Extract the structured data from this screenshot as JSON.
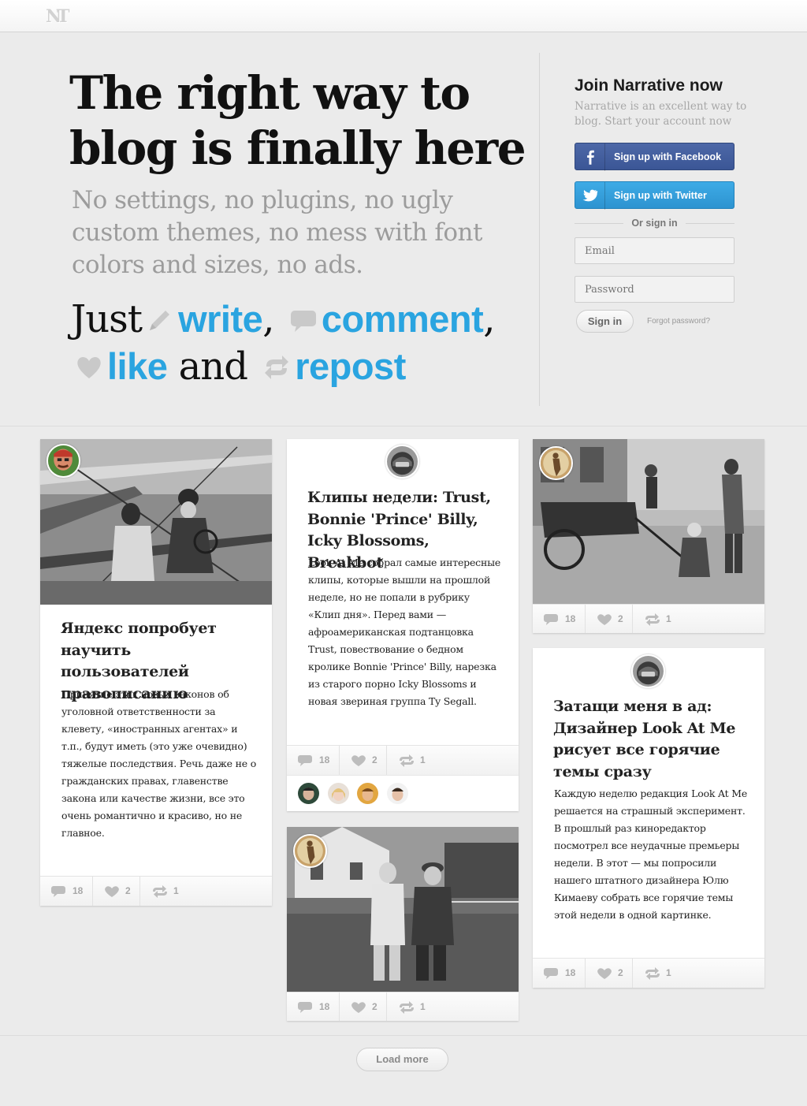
{
  "hero": {
    "headline": "The right way to blog is finally here",
    "subhead": "No settings, no plugins, no ugly custom themes, no mess with font colors and sizes, no ads.",
    "just": "Just",
    "write": "write",
    "comma1": ",",
    "comment": "comment",
    "comma2": ",",
    "like": "like",
    "and": "and",
    "repost": "repost",
    "accent_color": "#2aa4e0"
  },
  "signup": {
    "title": "Join Narrative now",
    "lead": "Narrative is an excellent way to blog. Start your account now",
    "facebook_label": "Sign up with Facebook",
    "twitter_label": "Sign up with Twitter",
    "or_sign_in": "Or sign in",
    "email_placeholder": "Email",
    "password_placeholder": "Password",
    "sign_in_label": "Sign in",
    "forgot_label": "Forgot password?",
    "facebook_color": "#3b5696",
    "twitter_color": "#2d93d0"
  },
  "posts": [
    {
      "title": "Яндекс попробует научить пользователей правописанию",
      "text": "Принятие этих новых законов об уголовной ответственности за клевету, «иностранных агентах» и т.п., будут иметь (это уже очевидно) тяжелые последствия. Речь даже не о гражданских правах, главенстве закона или качестве жизни, все это очень романтично и красиво, но не главное.",
      "comments": "18",
      "likes": "2",
      "reposts": "1"
    },
    {
      "title": "Клипы недели: Trust, Bonnie 'Prince' Billy, Icky Blossoms, Breakbot",
      "text": "Look At Me собрал самые интересные клипы, которые вышли на прошлой неделе, но не попали в рубрику «Клип дня». Перед вами — афроамериканская подтанцовка Trust, повествование о бедном кролике Bonnie 'Prince' Billy, нарезка из старого порно Icky Blossoms и новая звериная группа Ty Segall.",
      "comments": "18",
      "likes": "2",
      "reposts": "1"
    },
    {
      "comments": "18",
      "likes": "2",
      "reposts": "1"
    },
    {
      "comments": "18",
      "likes": "2",
      "reposts": "1"
    },
    {
      "title": "Затащи меня в ад: Дизайнер Look At Me рисует все горячие темы сразу",
      "text": "Каждую неделю редакция Look At Me решается на страшный эксперимент. В прошлый раз кинoредактор посмотрел все неудачные премьеры недели. В этот — мы попросили нашего штатного дизайнера Юлю Кимаеву собрать все горячие темы этой недели в одной картинке.",
      "comments": "18",
      "likes": "2",
      "reposts": "1"
    }
  ],
  "footer": {
    "load_more": "Load more"
  }
}
